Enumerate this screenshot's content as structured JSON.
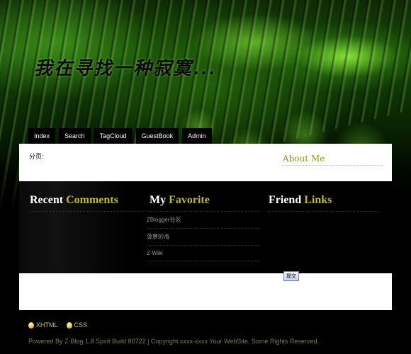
{
  "header": {
    "tagline": "我在寻找一种寂寞..."
  },
  "nav": [
    {
      "label": "Index"
    },
    {
      "label": "Search"
    },
    {
      "label": "TagCloud"
    },
    {
      "label": "GuestBook"
    },
    {
      "label": "Admin"
    }
  ],
  "content": {
    "pager_label": "分页:"
  },
  "sidebar": {
    "about_title": "About Me"
  },
  "columns": {
    "comments": {
      "title_lead": "Recent",
      "title_accent": "Comments"
    },
    "favorite": {
      "title_lead": "My",
      "title_accent": "Favorite",
      "items": [
        "ZBlogger社区",
        "菠萝的海",
        "Z-Wiki"
      ]
    },
    "links": {
      "title_lead": "Friend",
      "title_accent": "Links"
    }
  },
  "lower": {
    "button_label": "提交"
  },
  "footer": {
    "xhtml": "XHTML",
    "css": "CSS",
    "powered": "Powered By Z-Blog 1.8 Spirit Build 80722 | Copyright xxxx-xxxx Your WebSite. Some Rights Reserved."
  },
  "colors": {
    "accent": "#b8b640",
    "footer_text": "#7d7a55"
  },
  "icons": [
    "bulb-icon"
  ]
}
